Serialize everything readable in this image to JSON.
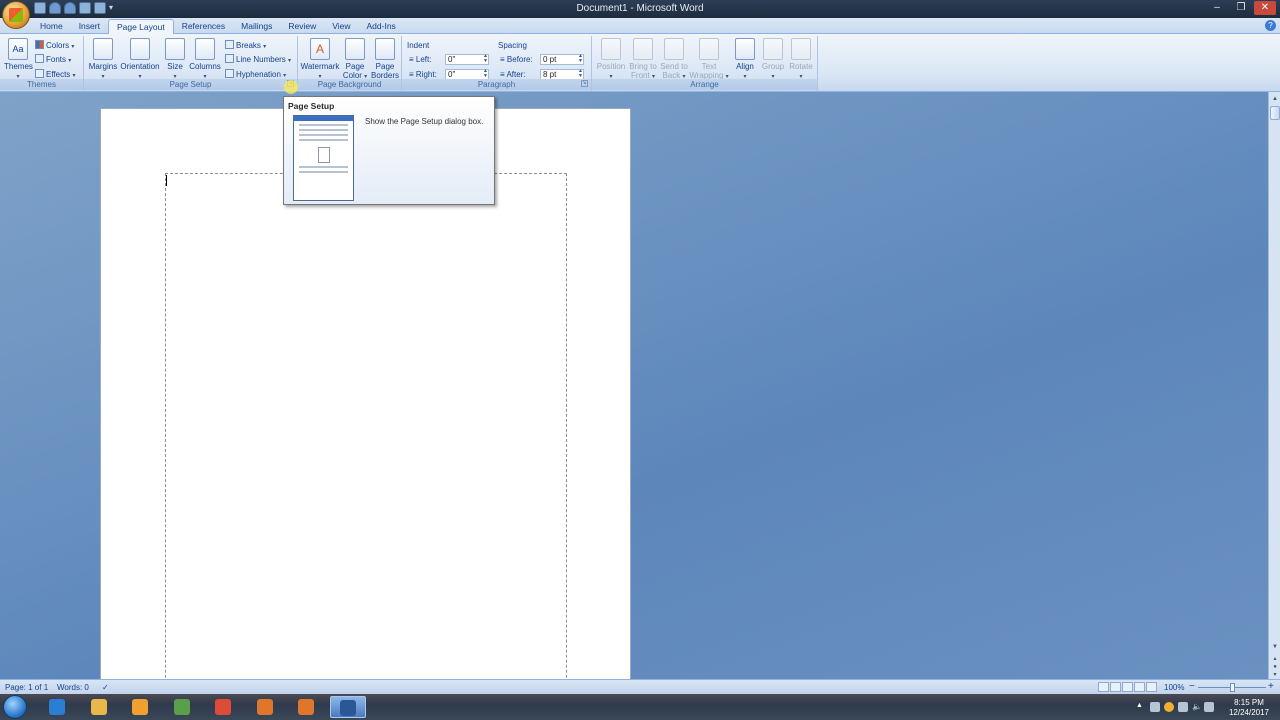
{
  "window": {
    "title": "Document1 - Microsoft Word",
    "minimize": "–",
    "restore": "❐",
    "close": "✕"
  },
  "tabs": [
    {
      "label": "Home"
    },
    {
      "label": "Insert"
    },
    {
      "label": "Page Layout",
      "active": true
    },
    {
      "label": "References"
    },
    {
      "label": "Mailings"
    },
    {
      "label": "Review"
    },
    {
      "label": "View"
    },
    {
      "label": "Add-Ins"
    }
  ],
  "help_glyph": "?",
  "ribbon": {
    "themes": {
      "group_label": "Themes",
      "themes_btn": "Themes",
      "colors": "Colors",
      "fonts": "Fonts",
      "effects": "Effects"
    },
    "page_setup": {
      "group_label": "Page Setup",
      "margins": "Margins",
      "orientation": "Orientation",
      "size": "Size",
      "columns": "Columns",
      "breaks": "Breaks",
      "line_numbers": "Line Numbers",
      "hyphenation": "Hyphenation"
    },
    "page_background": {
      "group_label": "Page Background",
      "watermark": "Watermark",
      "page_color_1": "Page",
      "page_color_2": "Color",
      "page_borders_1": "Page",
      "page_borders_2": "Borders"
    },
    "paragraph": {
      "group_label": "Paragraph",
      "indent_label": "Indent",
      "left_label": "Left:",
      "left_value": "0\"",
      "right_label": "Right:",
      "right_value": "0\"",
      "spacing_label": "Spacing",
      "before_label": "Before:",
      "before_value": "0 pt",
      "after_label": "After:",
      "after_value": "8 pt"
    },
    "arrange": {
      "group_label": "Arrange",
      "position": "Position",
      "bring_front_1": "Bring to",
      "bring_front_2": "Front",
      "send_back_1": "Send to",
      "send_back_2": "Back",
      "text_wrap_1": "Text",
      "text_wrap_2": "Wrapping",
      "align": "Align",
      "group": "Group",
      "rotate": "Rotate"
    }
  },
  "tooltip": {
    "title": "Page Setup",
    "description": "Show the Page Setup dialog box."
  },
  "status": {
    "page": "Page: 1 of 1",
    "words": "Words: 0",
    "zoom": "100%",
    "zoom_minus": "−",
    "zoom_plus": "+"
  },
  "taskbar": {
    "apps": [
      {
        "name": "internet-explorer",
        "color": "#2a7fd4"
      },
      {
        "name": "file-explorer",
        "color": "#e8b84a"
      },
      {
        "name": "media-player",
        "color": "#f0a030"
      },
      {
        "name": "app-green",
        "color": "#5aa04a"
      },
      {
        "name": "chrome",
        "color": "#dd4b39"
      },
      {
        "name": "app-orange-1",
        "color": "#e0752c"
      },
      {
        "name": "app-orange-2",
        "color": "#e0752c"
      },
      {
        "name": "word",
        "color": "#2b5797",
        "active": true
      }
    ],
    "time": "8:15 PM",
    "date": "12/24/2017"
  }
}
